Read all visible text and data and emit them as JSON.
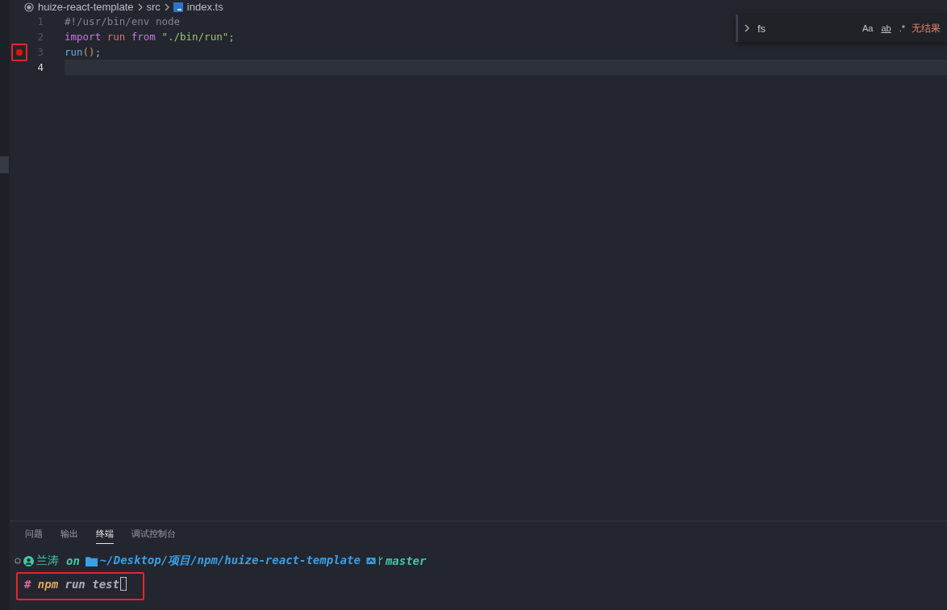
{
  "breadcrumb": [
    {
      "kind": "folder",
      "label": "huize-react-template"
    },
    {
      "kind": "folder",
      "label": "src"
    },
    {
      "kind": "file",
      "label": "index.ts"
    }
  ],
  "find_widget": {
    "value": "fs",
    "options": [
      {
        "label": "Aa",
        "selected": false
      },
      {
        "label": "ab",
        "selected": false
      },
      {
        "label": ".*",
        "selected": false
      }
    ],
    "result": "无结果"
  },
  "code_lines": [
    {
      "number": "1",
      "breakpoint": false,
      "current": false,
      "tokens": [
        {
          "kind": "comment",
          "text": "#!/usr/bin/env node"
        }
      ]
    },
    {
      "number": "2",
      "breakpoint": false,
      "current": false,
      "tokens": [
        {
          "kind": "keyword",
          "text": "import"
        },
        {
          "kind": "variable",
          "text": " run "
        },
        {
          "kind": "keyword",
          "text": "from"
        },
        {
          "kind": "string",
          "text": " \"./bin/run\""
        },
        {
          "kind": "plain",
          "text": ";"
        }
      ]
    },
    {
      "number": "3",
      "breakpoint": true,
      "current": false,
      "tokens": [
        {
          "kind": "function",
          "text": "run"
        },
        {
          "kind": "bracket",
          "text": "()"
        },
        {
          "kind": "plain",
          "text": ";"
        }
      ]
    },
    {
      "number": "4",
      "breakpoint": false,
      "current": true
    }
  ],
  "panel_tabs": [
    {
      "label": "问题",
      "selected": false
    },
    {
      "label": "输出",
      "selected": false
    },
    {
      "label": "终端",
      "selected": true
    },
    {
      "label": "调试控制台",
      "selected": false
    }
  ],
  "terminal": {
    "prompt": [
      {
        "kind": "user",
        "text": "兰涛"
      },
      {
        "kind": "on",
        "text": "on"
      },
      {
        "kind": "path",
        "text": "~/Desktop/项目/npm/huize-react-template"
      },
      {
        "kind": "branch",
        "text": "master"
      }
    ],
    "command": [
      {
        "kind": "hash",
        "text": "#"
      },
      {
        "kind": "cmd",
        "text": "npm"
      },
      {
        "kind": "args",
        "text": "run test"
      }
    ]
  }
}
